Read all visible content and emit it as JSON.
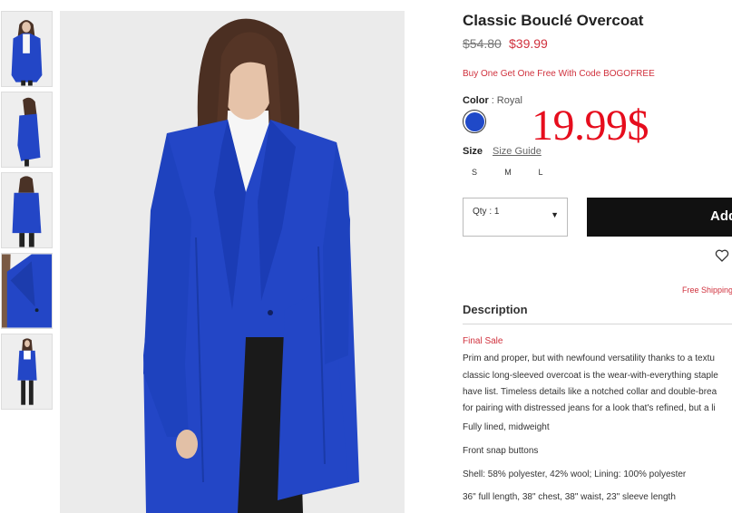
{
  "product": {
    "title": "Classic Bouclé Overcoat",
    "price_old": "$54.80",
    "price_new": "$39.99",
    "promo": "Buy One Get One Free With Code BOGOFREE",
    "color_label": "Color",
    "color_sep": ":",
    "color_value": "Royal",
    "swatch_color": "#1f49c8",
    "overlay_price": "19.99$",
    "size_label": "Size",
    "size_guide": "Size Guide",
    "sizes": [
      "S",
      "M",
      "L"
    ],
    "qty_label": "Qty : 1",
    "add_button": "Add",
    "free_shipping": "Free Shipping"
  },
  "description": {
    "heading": "Description",
    "final_sale": "Final Sale",
    "lines": [
      "Prim and proper, but with newfound versatility thanks to a textu",
      "classic long-sleeved overcoat is the wear-with-everything staple",
      "have list. Timeless details like a notched collar and double-brea",
      "for pairing with distressed jeans for a look that's refined, but a li",
      "Fully lined, midweight",
      "Front snap buttons",
      "Shell: 58% polyester, 42% wool; Lining: 100% polyester",
      "36\" full length, 38\" chest, 38\" waist, 23\" sleeve length"
    ]
  },
  "colors": {
    "accent_red": "#d0313d",
    "coat_blue": "#1f49c8",
    "button_black": "#111111"
  }
}
